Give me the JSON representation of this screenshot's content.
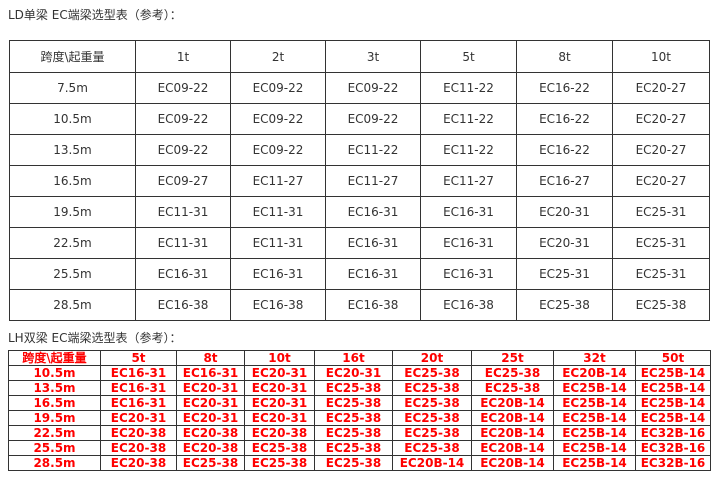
{
  "ld": {
    "caption": "LD单梁 EC端梁选型表（参考）：",
    "corner": "跨度\\起重量",
    "headers": [
      "1t",
      "2t",
      "3t",
      "5t",
      "8t",
      "10t"
    ],
    "rows": [
      {
        "span": "7.5m",
        "cells": [
          "EC09-22",
          "EC09-22",
          "EC09-22",
          "EC11-22",
          "EC16-22",
          "EC20-27"
        ]
      },
      {
        "span": "10.5m",
        "cells": [
          "EC09-22",
          "EC09-22",
          "EC09-22",
          "EC11-22",
          "EC16-22",
          "EC20-27"
        ]
      },
      {
        "span": "13.5m",
        "cells": [
          "EC09-22",
          "EC09-22",
          "EC11-22",
          "EC11-22",
          "EC16-22",
          "EC20-27"
        ]
      },
      {
        "span": "16.5m",
        "cells": [
          "EC09-27",
          "EC11-27",
          "EC11-27",
          "EC11-27",
          "EC16-27",
          "EC20-27"
        ]
      },
      {
        "span": "19.5m",
        "cells": [
          "EC11-31",
          "EC11-31",
          "EC16-31",
          "EC16-31",
          "EC20-31",
          "EC25-31"
        ]
      },
      {
        "span": "22.5m",
        "cells": [
          "EC11-31",
          "EC11-31",
          "EC16-31",
          "EC16-31",
          "EC20-31",
          "EC25-31"
        ]
      },
      {
        "span": "25.5m",
        "cells": [
          "EC16-31",
          "EC16-31",
          "EC16-31",
          "EC16-31",
          "EC25-31",
          "EC25-31"
        ]
      },
      {
        "span": "28.5m",
        "cells": [
          "EC16-38",
          "EC16-38",
          "EC16-38",
          "EC16-38",
          "EC25-38",
          "EC25-38"
        ]
      }
    ]
  },
  "lh": {
    "caption": "LH双梁 EC端梁选型表（参考）：",
    "corner": "跨度\\起重量",
    "headers": [
      "5t",
      "8t",
      "10t",
      "16t",
      "20t",
      "25t",
      "32t",
      "50t"
    ],
    "rows": [
      {
        "span": "10.5m",
        "cells": [
          "EC16-31",
          "EC16-31",
          "EC20-31",
          "EC20-31",
          "EC25-38",
          "EC25-38",
          "EC20B-14",
          "EC25B-14"
        ]
      },
      {
        "span": "13.5m",
        "cells": [
          "EC16-31",
          "EC20-31",
          "EC20-31",
          "EC25-38",
          "EC25-38",
          "EC25-38",
          "EC25B-14",
          "EC25B-14"
        ]
      },
      {
        "span": "16.5m",
        "cells": [
          "EC16-31",
          "EC20-31",
          "EC20-31",
          "EC25-38",
          "EC25-38",
          "EC20B-14",
          "EC25B-14",
          "EC25B-14"
        ]
      },
      {
        "span": "19.5m",
        "cells": [
          "EC20-31",
          "EC20-31",
          "EC20-31",
          "EC25-38",
          "EC25-38",
          "EC20B-14",
          "EC25B-14",
          "EC25B-14"
        ]
      },
      {
        "span": "22.5m",
        "cells": [
          "EC20-38",
          "EC20-38",
          "EC20-38",
          "EC25-38",
          "EC25-38",
          "EC20B-14",
          "EC25B-14",
          "EC32B-16"
        ]
      },
      {
        "span": "25.5m",
        "cells": [
          "EC20-38",
          "EC20-38",
          "EC25-38",
          "EC25-38",
          "EC25-38",
          "EC20B-14",
          "EC25B-14",
          "EC32B-16"
        ]
      },
      {
        "span": "28.5m",
        "cells": [
          "EC20-38",
          "EC25-38",
          "EC25-38",
          "EC25-38",
          "EC20B-14",
          "EC20B-14",
          "EC25B-14",
          "EC32B-16"
        ]
      }
    ]
  }
}
